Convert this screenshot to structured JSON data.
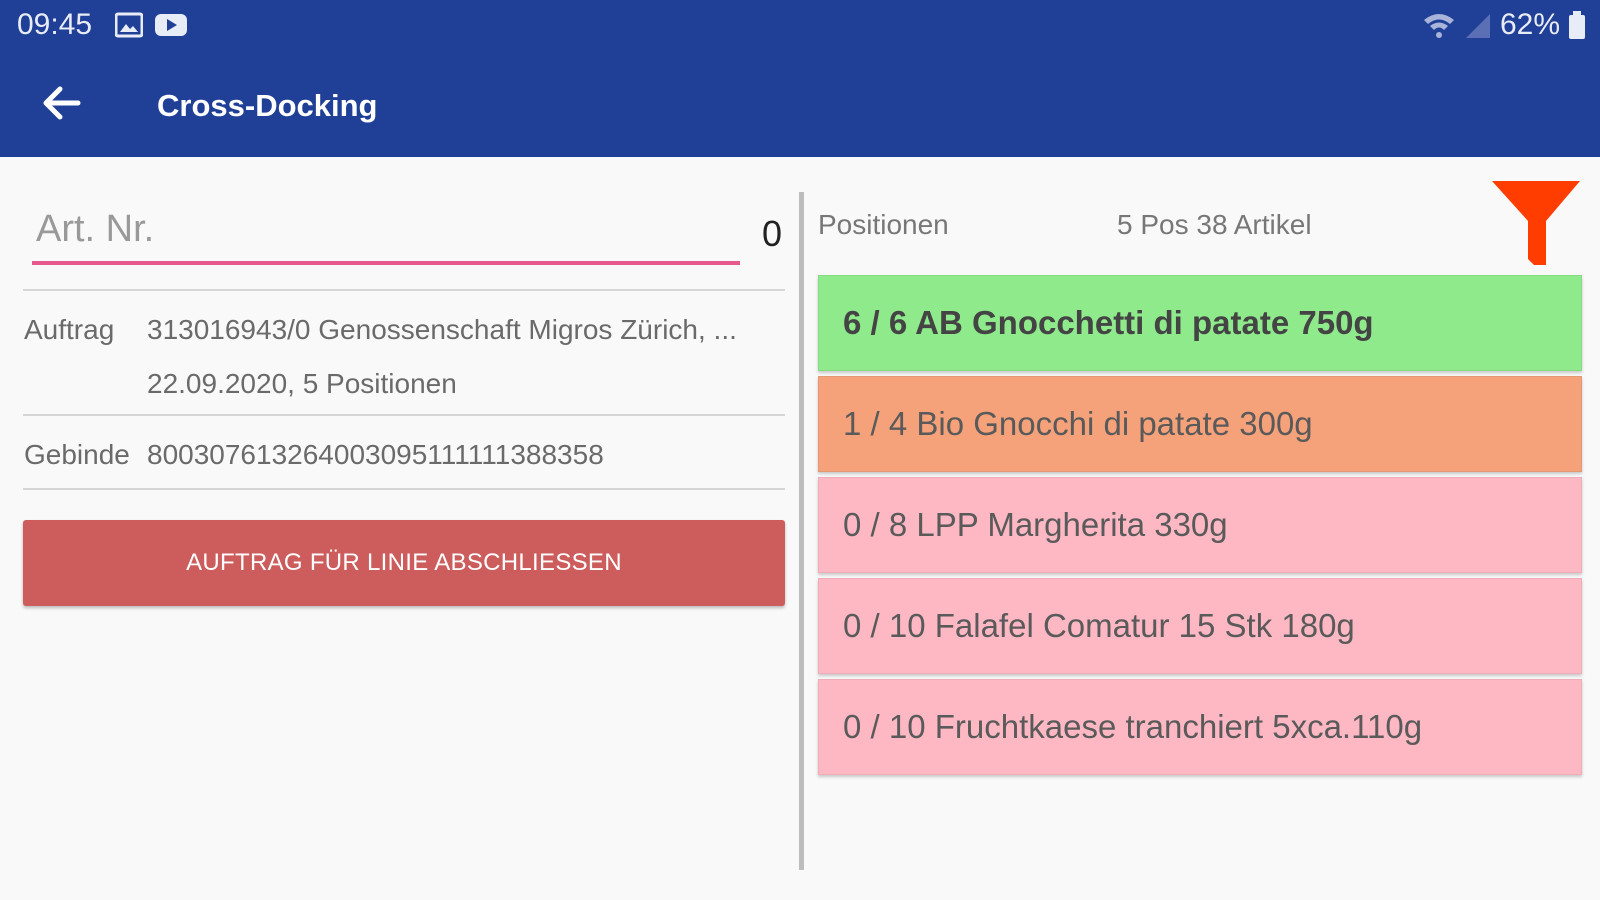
{
  "status_bar": {
    "time": "09:45",
    "battery": "62%",
    "icons": [
      "gallery-icon",
      "youtube-icon",
      "wifi-icon",
      "signal-icon",
      "battery-icon"
    ]
  },
  "app_bar": {
    "title": "Cross-Docking",
    "back_icon": "arrow-left-icon",
    "background": "#203f97"
  },
  "scan": {
    "placeholder": "Art. Nr.",
    "value": "",
    "count": "0"
  },
  "order": {
    "label": "Auftrag",
    "line1": "313016943/0 Genossenschaft Migros Zürich, ...",
    "line2": "22.09.2020, 5 Positionen"
  },
  "container": {
    "label": "Gebinde",
    "value": "800307613264003095111111388358"
  },
  "close_button": {
    "label": "AUFTRAG FÜR LINIE ABSCHLIESSEN",
    "color": "#cd5c5c"
  },
  "positions": {
    "label": "Positionen",
    "summary": "5 Pos  38 Artikel",
    "filter_icon": "filter-icon",
    "items": [
      {
        "text": "6 / 6 AB Gnocchetti di patate 750g",
        "color": "#8fea8c",
        "status": "complete"
      },
      {
        "text": "1 / 4 Bio Gnocchi di patate 300g",
        "color": "#f5a27a",
        "status": "partial"
      },
      {
        "text": "0 / 8 LPP Margherita 330g",
        "color": "#fdb8c4",
        "status": "open"
      },
      {
        "text": "0 / 10 Falafel Comatur 15 Stk 180g",
        "color": "#fdb8c4",
        "status": "open"
      },
      {
        "text": "0 / 10 Fruchtkaese tranchiert 5xca.110g",
        "color": "#fdb8c4",
        "status": "open"
      }
    ]
  }
}
